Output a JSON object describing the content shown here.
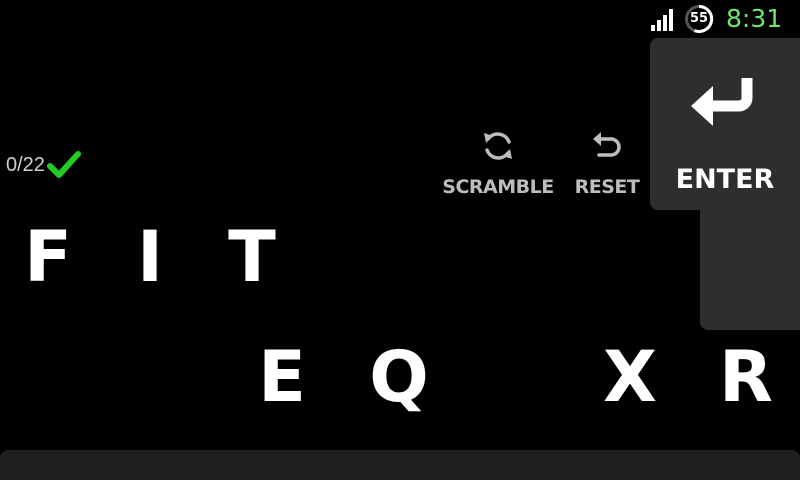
{
  "status_bar": {
    "battery_level": "55",
    "time": "8:31",
    "clock_color": "#6ee66e",
    "signal_icon": "signal-bars-icon",
    "battery_icon": "battery-circle-icon"
  },
  "score": {
    "text": "0/22",
    "check_icon": "check-icon",
    "check_color": "#22cc22"
  },
  "actions": {
    "scramble_label": "SCRAMBLE",
    "scramble_icon": "refresh-icon",
    "reset_label": "RESET",
    "reset_icon": "undo-icon"
  },
  "enter": {
    "label": "ENTER",
    "icon": "enter-arrow-icon"
  },
  "guess_letters": [
    "F",
    "I",
    "T"
  ],
  "pool_letters": [
    "E",
    "Q",
    "X",
    "R"
  ]
}
